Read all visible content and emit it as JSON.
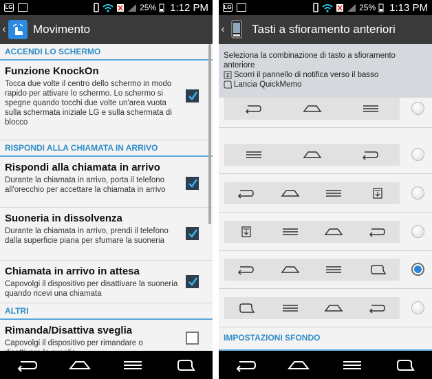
{
  "left": {
    "status": {
      "battery": "25%",
      "time": "1:12 PM"
    },
    "title": "Movimento",
    "sections": [
      {
        "header": "ACCENDI LO SCHERMO"
      },
      {
        "header": "RISPONDI ALLA CHIAMATA IN ARRIVO"
      },
      {
        "header": "ALTRI"
      }
    ],
    "items": [
      {
        "title": "Funzione KnockOn",
        "desc": "Tocca due volte il centro dello schermo in modo rapido per attivare lo schermo. Lo schermo si spegne quando tocchi due volte un'area vuota sulla schermata iniziale LG e sulla schermata di blocco",
        "checked": true
      },
      {
        "title": "Rispondi alla chiamata in arrivo",
        "desc": "Durante la chiamata in arrivo, porta il telefono all'orecchio per accettare la chiamata in arrivo",
        "checked": true
      },
      {
        "title": "Suoneria in dissolvenza",
        "desc": "Durante la chiamata in arrivo, prendi il telefono dalla superficie piana per sfumare la suoneria",
        "checked": true
      },
      {
        "title": "Chiamata in arrivo in attesa",
        "desc": "Capovolgi il dispositivo per disattivare la suoneria quando ricevi una chiamata",
        "checked": true
      },
      {
        "title": "Rimanda/Disattiva sveglia",
        "desc": "Capovolgi il dispositivo per rimandare o disattivare la sveglia",
        "checked": false
      }
    ]
  },
  "right": {
    "status": {
      "battery": "25%",
      "time": "1:13 PM"
    },
    "title": "Tasti a sfioramento anteriori",
    "info": {
      "text": "Seleziona la combinazione di tasto a sfioramento anteriore",
      "row1": "Scorri il pannello di notifica verso il basso",
      "row2": "Lancia QuickMemo"
    },
    "combos": [
      {
        "keys": [
          "back-icon",
          "home-icon",
          "menu-icon"
        ],
        "selected": false
      },
      {
        "keys": [
          "menu-icon",
          "home-icon",
          "back-icon"
        ],
        "selected": false
      },
      {
        "keys": [
          "back-icon",
          "home-icon",
          "menu-icon",
          "notification-icon"
        ],
        "selected": false
      },
      {
        "keys": [
          "notification-icon",
          "menu-icon",
          "home-icon",
          "back-icon"
        ],
        "selected": false
      },
      {
        "keys": [
          "back-icon",
          "home-icon",
          "menu-icon",
          "quickmemo-icon"
        ],
        "selected": true
      },
      {
        "keys": [
          "quickmemo-icon",
          "menu-icon",
          "home-icon",
          "back-icon"
        ],
        "selected": false
      }
    ],
    "section2": "IMPOSTAZIONI SFONDO"
  },
  "navbar": [
    "back-icon",
    "home-icon",
    "menu-icon",
    "quickmemo-icon"
  ],
  "colors": {
    "accent": "#2f8cc7",
    "actionbar": "#3a3a3a",
    "radio_selected": "#2a85d6",
    "checkbox": "#2e3e4e"
  }
}
